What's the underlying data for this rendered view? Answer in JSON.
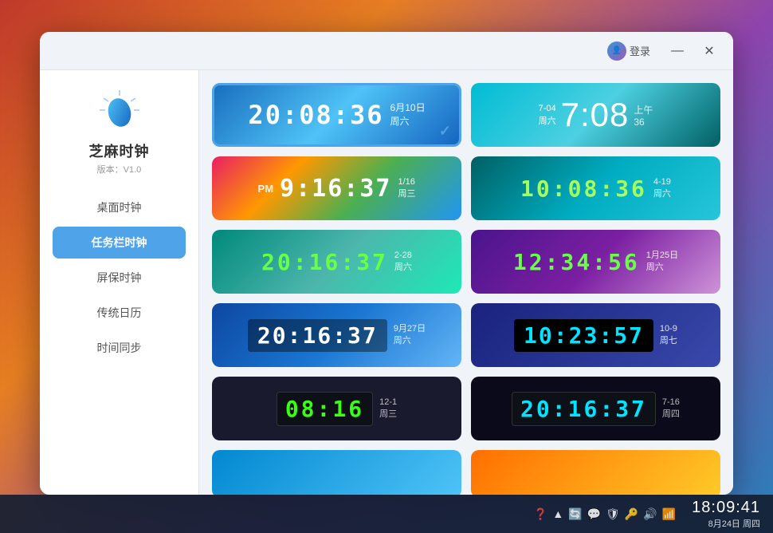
{
  "app": {
    "name": "芝麻时钟",
    "version": "版本：V1.0"
  },
  "titlebar": {
    "login_label": "登录",
    "minimize_label": "—",
    "close_label": "✕"
  },
  "sidebar": {
    "items": [
      {
        "id": "desktop-clock",
        "label": "桌面时钟",
        "active": false
      },
      {
        "id": "taskbar-clock",
        "label": "任务栏时钟",
        "active": true
      },
      {
        "id": "screensaver-clock",
        "label": "屏保时钟",
        "active": false
      },
      {
        "id": "traditional-calendar",
        "label": "传统日历",
        "active": false
      },
      {
        "id": "time-sync",
        "label": "时间同步",
        "active": false
      }
    ]
  },
  "clocks": [
    {
      "id": "clock-1",
      "time": "20:08:36",
      "date": "6月10日",
      "weekday": "周六",
      "style": "blue-gradient",
      "selected": true
    },
    {
      "id": "clock-2",
      "date_top": "7-04",
      "weekday": "周六",
      "time": "7:08",
      "ampm": "上午",
      "minutes": "36",
      "style": "cyan-large"
    },
    {
      "id": "clock-3",
      "ampm": "PM",
      "time": "9:16:37",
      "date": "1/16",
      "weekday": "周三",
      "style": "colorful"
    },
    {
      "id": "clock-4",
      "time": "10:08:36",
      "date": "4-19",
      "weekday": "周六",
      "style": "green-lcd-cyan"
    },
    {
      "id": "clock-5",
      "time": "20:16:37",
      "date": "2-28",
      "weekday": "周六",
      "style": "green-digital"
    },
    {
      "id": "clock-6",
      "time": "12:34:56",
      "date": "1月25日",
      "weekday": "周六",
      "style": "purple-green"
    },
    {
      "id": "clock-7",
      "time": "20:16:37",
      "date": "9月27日",
      "weekday": "周六",
      "style": "blue-box"
    },
    {
      "id": "clock-8",
      "time": "10:23:57",
      "date": "10-9",
      "weekday": "周七",
      "style": "dark-cyan"
    },
    {
      "id": "clock-9",
      "time": "08:16",
      "date": "12-1",
      "weekday": "周三",
      "style": "dark-green-lcd"
    },
    {
      "id": "clock-10",
      "time": "20:16:37",
      "date": "7-16",
      "weekday": "周四",
      "style": "dark-cyan-large"
    }
  ],
  "taskbar": {
    "time": "18:09:41",
    "date": "8月24日",
    "weekday": "周四"
  }
}
